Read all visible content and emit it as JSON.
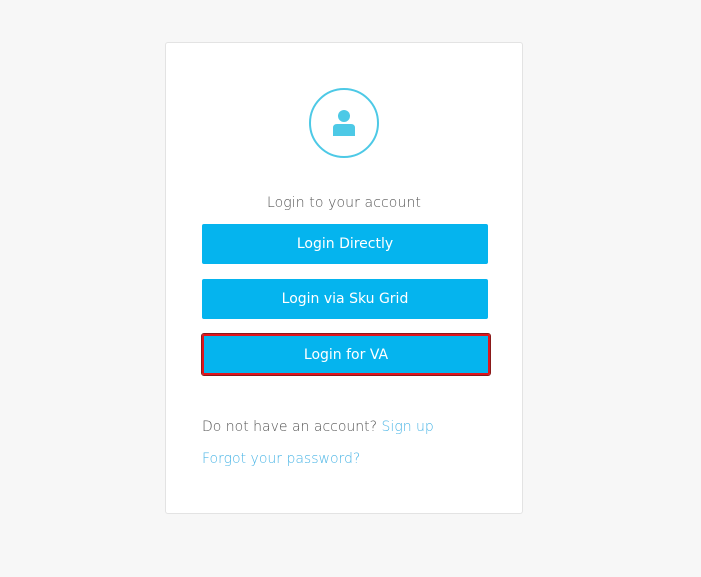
{
  "login": {
    "title": "Login to your account",
    "buttons": {
      "directly": "Login Directly",
      "sku_grid": "Login via Sku Grid",
      "va": "Login for VA"
    },
    "signup_prompt": "Do not have an account?",
    "signup_link": "Sign up",
    "forgot_link": "Forgot your password?"
  },
  "icons": {
    "avatar": "user-icon"
  },
  "colors": {
    "accent": "#05b4ee",
    "avatar_ring": "#4dc9e6",
    "highlight_border": "#e0151d",
    "link": "#4db6e6"
  }
}
